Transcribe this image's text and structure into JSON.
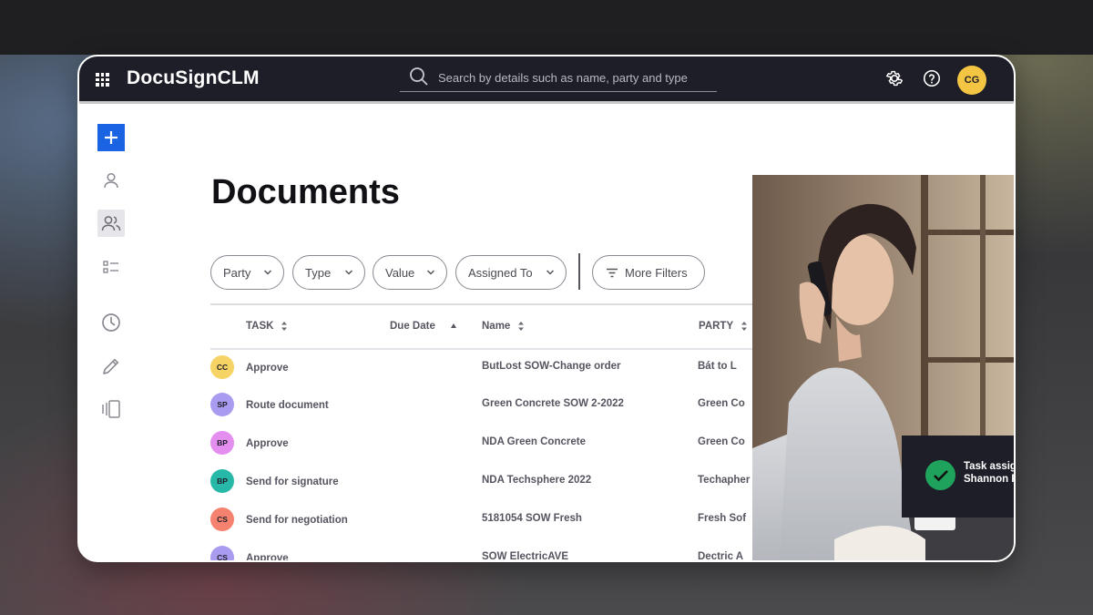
{
  "app": {
    "brand": "DocuSignCLM",
    "user_initials": "CG",
    "accent_color": "#1a64e3",
    "user_avatar_color": "#f4c542"
  },
  "search": {
    "placeholder": "Search by details such as name, party and type"
  },
  "header_icons": [
    "grid-icon",
    "search-icon",
    "gear-icon",
    "help-icon"
  ],
  "sidebar": {
    "items": [
      {
        "icon": "plus-icon"
      },
      {
        "icon": "user-icon"
      },
      {
        "icon": "users-icon"
      },
      {
        "icon": "list-icon"
      },
      {
        "icon": "clock-icon"
      },
      {
        "icon": "pencil-icon"
      },
      {
        "icon": "documents-stack-icon"
      }
    ]
  },
  "page": {
    "title": "Documents"
  },
  "filters": {
    "items": [
      "Party",
      "Type",
      "Value",
      "Assigned To"
    ],
    "more": "More Filters"
  },
  "table": {
    "columns": {
      "task": "TASK",
      "due_date": "Due Date",
      "name": "Name",
      "party": "PARTY"
    },
    "rows": [
      {
        "initials": "CC",
        "avatar_color": "#f6d365",
        "task": "Approve",
        "name": "ButLost SOW-Change order",
        "party": "Bát to L"
      },
      {
        "initials": "SP",
        "avatar_color": "#a99cf0",
        "task": "Route document",
        "name": "Green Concrete SOW 2-2022",
        "party": "Green Co"
      },
      {
        "initials": "BP",
        "avatar_color": "#e48ef0",
        "task": "Approve",
        "name": "NDA Green Concrete",
        "party": "Green Co"
      },
      {
        "initials": "BP",
        "avatar_color": "#27b8a8",
        "task": "Send for signature",
        "name": "NDA Techsphere 2022",
        "party": "Techapher"
      },
      {
        "initials": "CS",
        "avatar_color": "#f4826f",
        "task": "Send for negotiation",
        "name": "5181054 SOW Fresh",
        "party": "Fresh Sof"
      },
      {
        "initials": "CS",
        "avatar_color": "#a99cf0",
        "task": "Approve",
        "name": "SOW ElectricAVE",
        "party": "Dectric A"
      }
    ]
  },
  "toast": {
    "line1": "Task assig",
    "line2": "Shannon F",
    "icon": "check-icon",
    "color": "#1fa35c"
  }
}
